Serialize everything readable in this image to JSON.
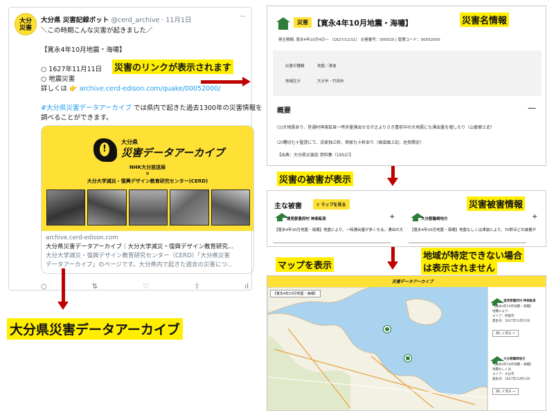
{
  "tweet": {
    "avatar_text": "大分\n災害",
    "author_name": "大分県 災害記録ボット",
    "handle": "@cerd_archive",
    "date": "· 11月1日",
    "lines": [
      "＼この時期こんな災害が起きました／",
      "",
      "【寛永4年10月地震・海嘯】",
      "",
      "○ 1627年11月11日",
      "○ 地震災害"
    ],
    "detail_prefix": "詳しくは 👉 ",
    "detail_link": "archive.cerd-edison.com/quake/00052000/",
    "hashtag": "#大分県災害データアーカイブ",
    "hashtag_rest": " では県内で起きた過去1300年の災害情報を",
    "line_last": "調べることができます。",
    "card": {
      "logo_small": "大分県",
      "logo_big": "災害データアーカイブ",
      "org_line1": "NHK大分放送局",
      "org_line2": "×",
      "org_line3": "大分大学減災・復興デザイン教育研究センター(CERD)",
      "domain": "archive.cerd-edison.com",
      "title": "大分県災害データアーカイブ｜大分大学減災・復興デザイン教育研究...",
      "desc1": "大分大学減災・復興デザイン教育研究センター（CERD）「大分県災害",
      "desc2": "データアーカイブ」のページです。大分県内で起きた過去の災害につ..."
    },
    "actions": [
      "○",
      "⇅",
      "♡",
      "⇧",
      "ıl"
    ]
  },
  "annotations": {
    "link_label": "災害のリンクが表示されます",
    "archive_label": "大分県災害データアーカイブ",
    "disaster_name_label": "災害名情報",
    "damage_shown_label": "災害の被害が表示",
    "damage_info_label": "災害被害情報",
    "map_label": "マップを表示",
    "note_label_1": "地域が特定できない場合",
    "note_label_2": "は表示されません"
  },
  "disaster": {
    "tag": "災害",
    "title": "【寛永4年10月地震・海嘯】",
    "meta": "発生期間: 寛永4年10月4日～ （1627/11/11） 災害番号：000520 | 管理コード：00052000",
    "info_rows": [
      {
        "label": "災害の種類",
        "value": "地震／津波"
      },
      {
        "label": "地域区分",
        "value": "大分市・竹田市"
      }
    ],
    "overview_title": "概要",
    "collapse": "—",
    "overview_lines": [
      "(1)大地震あり、笹通村神楽鉱泉一時多量湧出せるが之よりさき豊前中の大地震にも湧出量を増したり（山香郷土史）",
      "(2)曙切七十聖提にて、流家独三軒、倒家九十軒あり（高田風土記、佐賀関史）",
      "【出典：大分県災害誌 資料集（1952）】"
    ]
  },
  "damage": {
    "title": "主な被害",
    "map_button": "マップを見る",
    "items": [
      {
        "place": "速見郡豊府村 神楽鉱泉",
        "text": "【寛永4年10月地震・海嘯】地震により、一時湧出量が多くなる。湧出の大"
      },
      {
        "place": "大分郡鶴崎地方",
        "text": "【寛永4年10月地震・海嘯】地震もしくは津波により、70軒ほどの被害が"
      }
    ]
  },
  "map": {
    "title_chip": "【寛永4年10月地震・海嘯】",
    "side": [
      {
        "place": "速見郡豊府村 神楽鉱泉",
        "l1": "【寛永4年10月地震・海嘯】",
        "l2": "地震により、",
        "area": "エリア：杵築市",
        "date": "発生日：1627年11月11日",
        "btn": "詳しく見る →"
      },
      {
        "place": "大分郡鶴崎地方",
        "l1": "【寛永4年10月地震・海嘯】",
        "l2": "地震もしくは",
        "area": "エリア：大分市",
        "date": "発生日：1627年11月11日",
        "btn": "詳しく見る →"
      }
    ]
  },
  "colors": {
    "accent_yellow": "#ffe135",
    "arrow_red": "#c00000",
    "icon_green": "#2f7d3a",
    "link_blue": "#1d9bf0"
  }
}
